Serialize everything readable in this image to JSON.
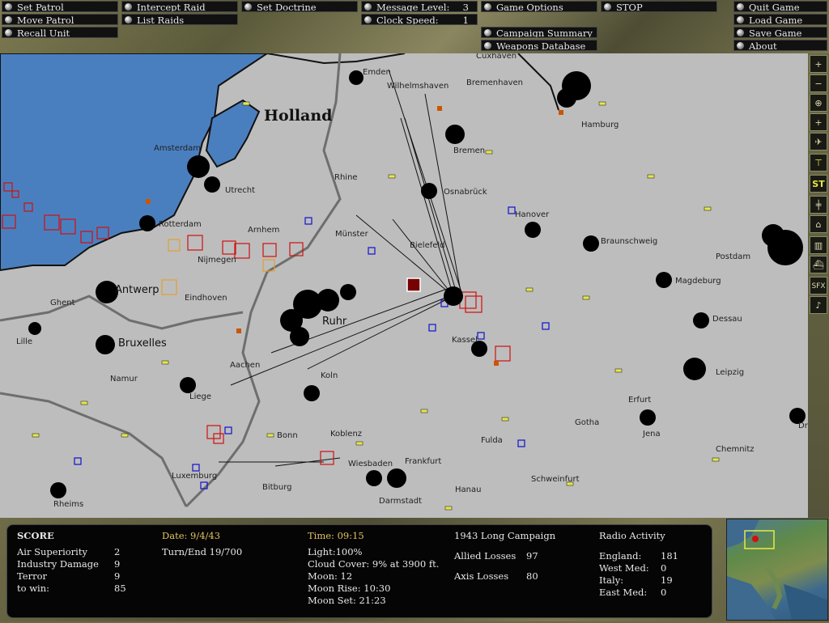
{
  "menu": {
    "set_patrol": "Set Patrol",
    "move_patrol": "Move Patrol",
    "recall_unit": "Recall Unit",
    "intercept_raid": "Intercept Raid",
    "list_raids": "List Raids",
    "set_doctrine": "Set Doctrine",
    "message_level_label": "Message Level:",
    "message_level_value": "3",
    "clock_speed_label": "Clock Speed:",
    "clock_speed_value": "1",
    "game_options": "Game Options",
    "stop": "STOP",
    "campaign_summary": "Campaign Summary",
    "weapons_database": "Weapons Database",
    "quit_game": "Quit Game",
    "load_game": "Load Game",
    "save_game": "Save Game",
    "about": "About"
  },
  "map": {
    "region_label": "Holland",
    "cities": [
      "Emden",
      "Wilhelmshaven",
      "Cuxhaven",
      "Bremenhaven",
      "Hamburg",
      "Bremen",
      "Amsterdam",
      "Utrecht",
      "Rhine",
      "Osnabrück",
      "Rotterdam",
      "Arnhem",
      "Hanover",
      "Münster",
      "Bielefeld",
      "Braunschweig",
      "Postdam",
      "Nijmegen",
      "Magdeburg",
      "Antwerp",
      "Eindhoven",
      "Dessau",
      "Ruhr",
      "Ghent",
      "Bruxelles",
      "Lille",
      "Kassel",
      "Aachen",
      "Namur",
      "Leipzig",
      "Koln",
      "Liege",
      "Erfurt",
      "Gotha",
      "Jena",
      "Dresden",
      "Bonn",
      "Koblenz",
      "Fulda",
      "Chemnitz",
      "Wiesbaden",
      "Frankfurt",
      "Luxemburg",
      "Bitburg",
      "Hanau",
      "Schweinfurt",
      "Rheims",
      "Darmstadt"
    ]
  },
  "toolbar": {
    "zoom_in": "+",
    "zoom_out": "−",
    "center": "⊕",
    "st": "ST",
    "sfx": "SFX",
    "music": "♪"
  },
  "score": {
    "title": "SCORE",
    "air_superiority_label": "Air Superiority",
    "air_superiority_value": "2",
    "industry_damage_label": "Industry Damage",
    "industry_damage_value": "9",
    "terror_label": "Terror",
    "terror_value": "9",
    "to_win_label": "to win:",
    "to_win_value": "85"
  },
  "status": {
    "date": "Date: 9/4/43",
    "turn_end": "Turn/End 19/700",
    "time": "Time: 09:15",
    "light": "Light:100%",
    "cloud_cover": "Cloud Cover: 9% at 3900 ft.",
    "moon": "Moon: 12",
    "moon_rise": "Moon Rise: 10:30",
    "moon_set": "Moon Set: 21:23"
  },
  "campaign": {
    "name": "1943 Long Campaign",
    "allied_losses_label": "Allied Losses",
    "allied_losses_value": "97",
    "axis_losses_label": "Axis Losses",
    "axis_losses_value": "80"
  },
  "radio": {
    "title": "Radio Activity",
    "england_label": "England:",
    "england_value": "181",
    "west_med_label": "West Med:",
    "west_med_value": "0",
    "italy_label": "Italy:",
    "italy_value": "19",
    "east_med_label": "East Med:",
    "east_med_value": "0"
  }
}
